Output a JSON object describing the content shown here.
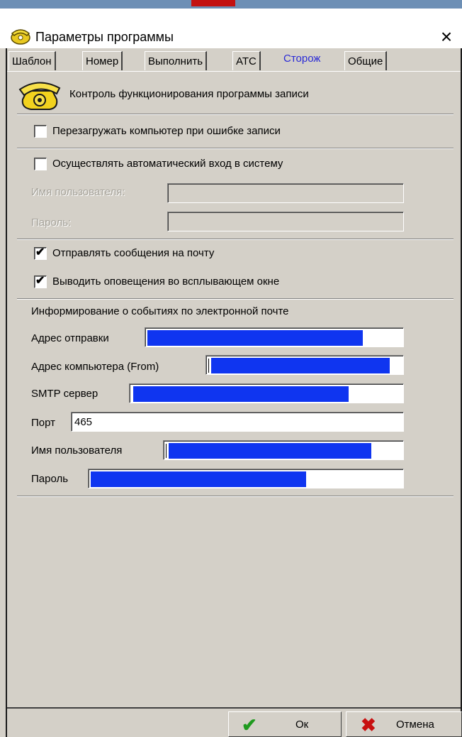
{
  "window": {
    "title": "Параметры программы",
    "close_glyph": "×",
    "icon": "phone-icon"
  },
  "tabs": [
    {
      "label": "Шаблон",
      "active": false
    },
    {
      "label": "Номер",
      "active": false
    },
    {
      "label": "Выполнить",
      "active": false
    },
    {
      "label": "АТС",
      "active": false
    },
    {
      "label": "Сторож",
      "active": true
    },
    {
      "label": "Общие",
      "active": false
    }
  ],
  "header": {
    "text": "Контроль функционирования программы записи",
    "icon": "telephone-icon"
  },
  "options": {
    "restart_on_error": {
      "label": "Перезагружать компьютер при ошибке записи",
      "checked": false
    },
    "auto_login": {
      "label": "Осуществлять автоматический вход в систему",
      "checked": false
    },
    "login_user_label": "Имя пользователя:",
    "login_password_label": "Пароль:",
    "send_mail": {
      "label": "Отправлять сообщения на почту",
      "checked": true
    },
    "popup_notify": {
      "label": "Выводить оповещения во всплывающем окне",
      "checked": true
    },
    "check_mark": "✔"
  },
  "email": {
    "section_title": "Информирование о событиях по электронной почте",
    "sender_label": "Адрес отправки",
    "from_label": "Адрес компьютера (From)",
    "smtp_label": "SMTP сервер",
    "port_label": "Порт",
    "port_value": "465",
    "user_label": "Имя пользователя",
    "password_label": "Пароль",
    "redacted_color": "#0f35f0"
  },
  "buttons": {
    "ok_label": "Ок",
    "ok_icon": "checkmark-icon",
    "ok_glyph": "✔",
    "cancel_label": "Отмена",
    "cancel_icon": "cross-icon",
    "cancel_glyph": "✖"
  }
}
